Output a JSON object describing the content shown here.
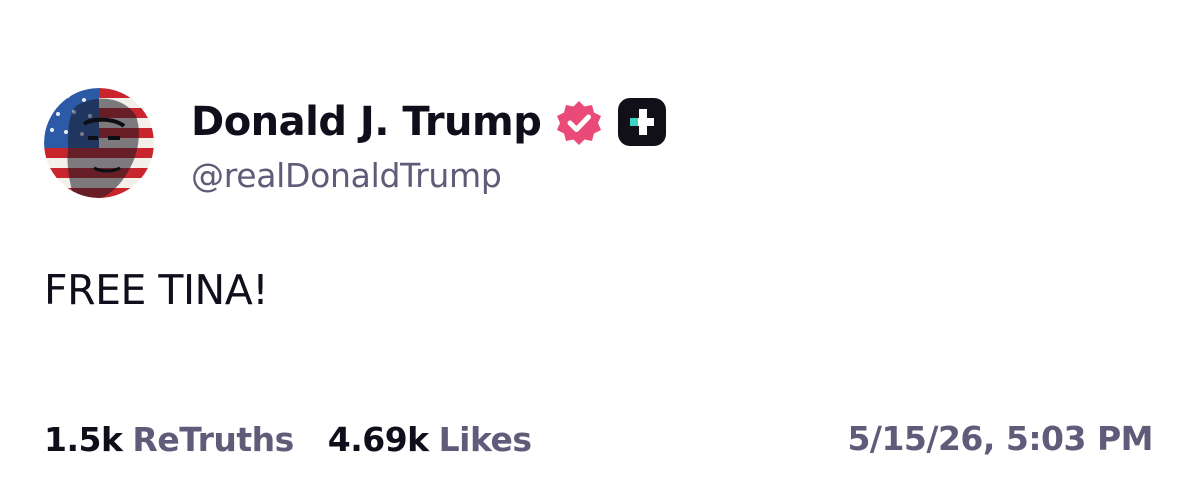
{
  "post": {
    "author": {
      "name": "Donald J. Trump",
      "handle": "@realDonaldTrump",
      "avatar_icon": "flag-portrait-avatar",
      "verified_icon": "verified-badge-icon",
      "plus_icon": "truth-plus-badge-icon"
    },
    "body": "FREE TINA!",
    "stats": {
      "retruths_count": "1.5k",
      "retruths_label": "ReTruths",
      "likes_count": "4.69k",
      "likes_label": "Likes"
    },
    "timestamp": "5/15/26, 5:03 PM"
  },
  "colors": {
    "text_primary": "#0f0e1a",
    "text_secondary": "#5e5c78",
    "verified_pink": "#e94a78",
    "plus_badge_bg": "#111018",
    "plus_badge_accent": "#3ad4c2"
  }
}
